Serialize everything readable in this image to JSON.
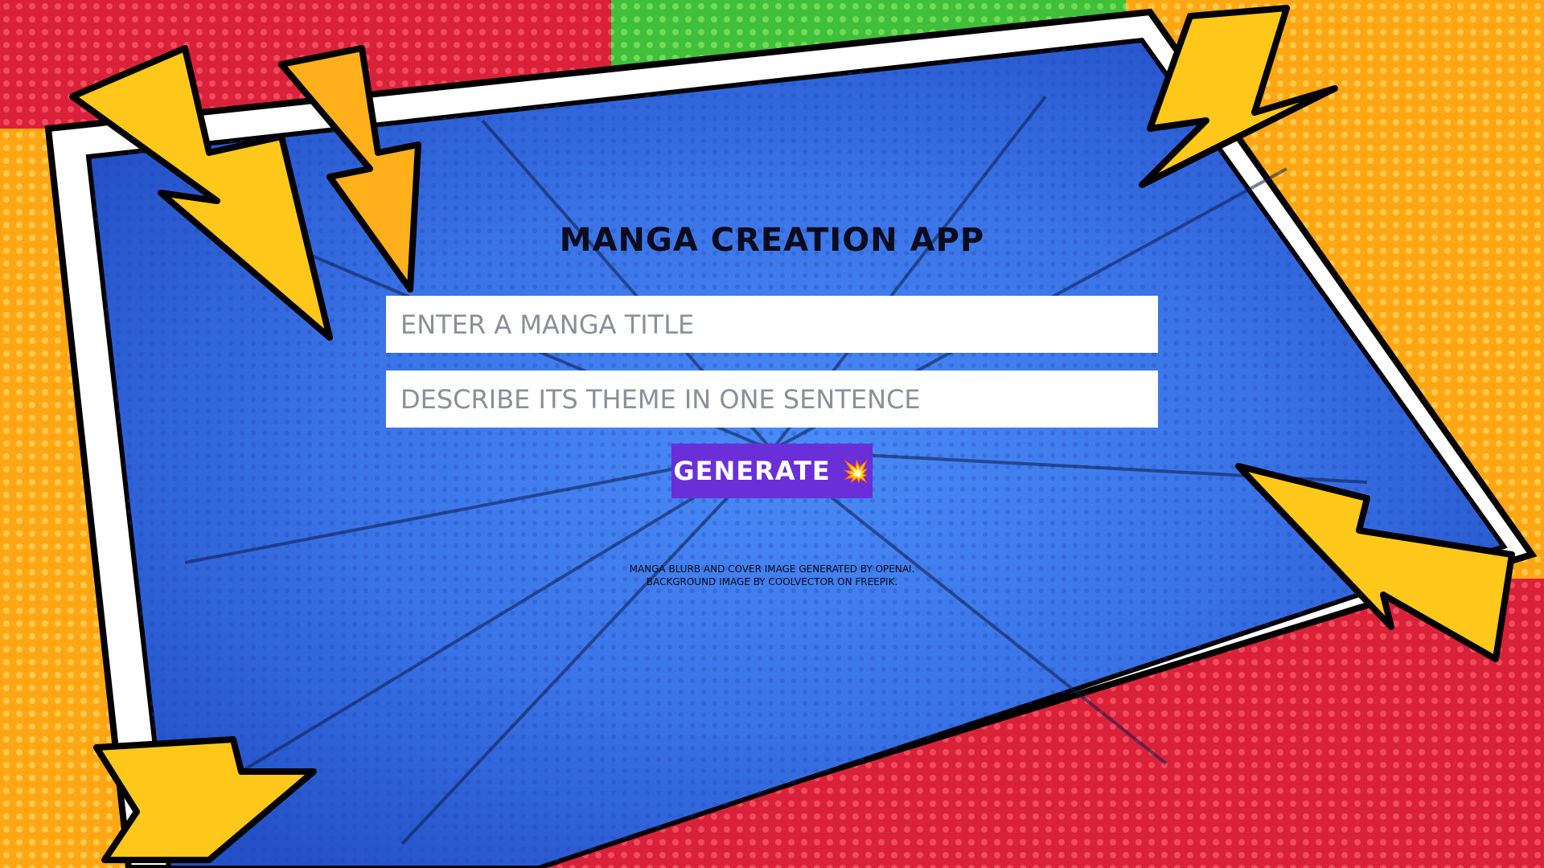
{
  "app": {
    "title": "MANGA CREATION APP"
  },
  "form": {
    "title_placeholder": "ENTER A MANGA TITLE",
    "title_value": "",
    "theme_placeholder": "DESCRIBE ITS THEME IN ONE SENTENCE",
    "theme_value": "",
    "generate_label": "GENERATE",
    "generate_icon": "💥"
  },
  "credits": {
    "line1": "MANGA BLURB AND COVER IMAGE GENERATED BY OPENAI.",
    "line2": "BACKGROUND IMAGE BY COOLVECTOR ON FREEPIK."
  },
  "colors": {
    "center_blue": "#3f7ff0",
    "panel_red": "#d9213a",
    "panel_orange": "#ffa614",
    "panel_green": "#3fbf3a",
    "bolt_yellow": "#ffc81a",
    "button_purple": "#6a2fd9"
  }
}
